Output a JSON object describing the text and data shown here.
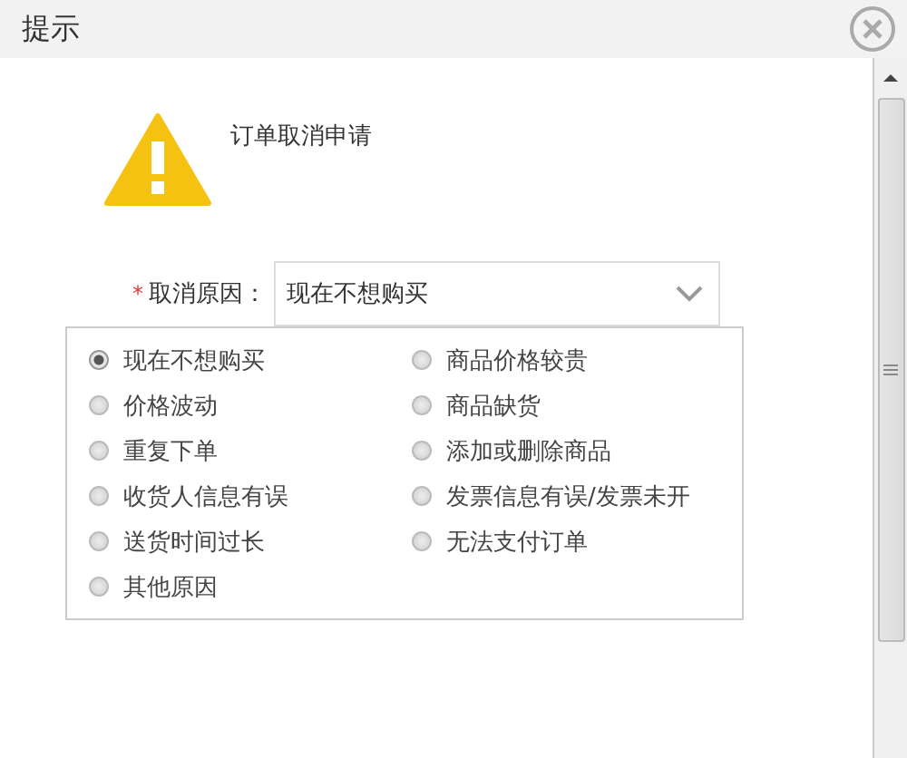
{
  "dialog": {
    "title": "提示"
  },
  "message": "订单取消申请",
  "reason_field": {
    "required_mark": "*",
    "label": "取消原因：",
    "value": "现在不想购买"
  },
  "options": [
    {
      "label": "现在不想购买",
      "selected": true
    },
    {
      "label": "商品价格较贵",
      "selected": false
    },
    {
      "label": "价格波动",
      "selected": false
    },
    {
      "label": "商品缺货",
      "selected": false
    },
    {
      "label": "重复下单",
      "selected": false
    },
    {
      "label": "添加或删除商品",
      "selected": false
    },
    {
      "label": "收货人信息有误",
      "selected": false
    },
    {
      "label": "发票信息有误/发票未开",
      "selected": false
    },
    {
      "label": "送货时间过长",
      "selected": false
    },
    {
      "label": "无法支付订单",
      "selected": false
    },
    {
      "label": "其他原因",
      "selected": false
    }
  ]
}
